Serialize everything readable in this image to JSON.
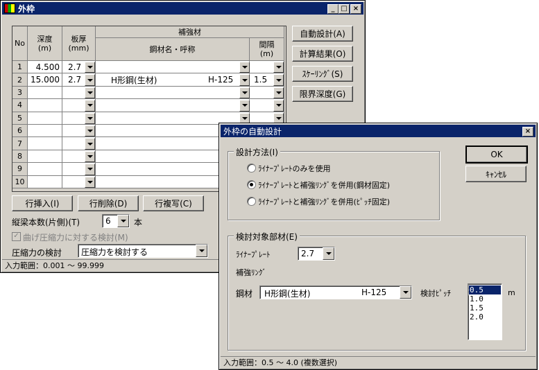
{
  "main_window": {
    "title": "外枠",
    "grid": {
      "headers": {
        "no": "No",
        "depth": "深度\n(m)",
        "thickness": "板厚\n(mm)",
        "reinforcement": "補強材",
        "steel_name": "鋼材名・呼称",
        "spacing": "間隔\n(m)"
      },
      "rows": [
        {
          "no": "1",
          "depth": "4.500",
          "thickness": "2.7",
          "steel_name": "",
          "steel_code": "",
          "spacing": ""
        },
        {
          "no": "2",
          "depth": "15.000",
          "thickness": "2.7",
          "steel_name": "H形鋼(生材)",
          "steel_code": "H-125",
          "spacing": "1.5"
        },
        {
          "no": "3",
          "depth": "",
          "thickness": "",
          "steel_name": "",
          "steel_code": "",
          "spacing": ""
        },
        {
          "no": "4",
          "depth": "",
          "thickness": "",
          "steel_name": "",
          "steel_code": "",
          "spacing": ""
        },
        {
          "no": "5",
          "depth": "",
          "thickness": "",
          "steel_name": "",
          "steel_code": "",
          "spacing": ""
        },
        {
          "no": "6",
          "depth": "",
          "thickness": "",
          "steel_name": "",
          "steel_code": "",
          "spacing": ""
        },
        {
          "no": "7",
          "depth": "",
          "thickness": "",
          "steel_name": "",
          "steel_code": "",
          "spacing": ""
        },
        {
          "no": "8",
          "depth": "",
          "thickness": "",
          "steel_name": "",
          "steel_code": "",
          "spacing": ""
        },
        {
          "no": "9",
          "depth": "",
          "thickness": "",
          "steel_name": "",
          "steel_code": "",
          "spacing": ""
        },
        {
          "no": "10",
          "depth": "",
          "thickness": "",
          "steel_name": "",
          "steel_code": "",
          "spacing": ""
        }
      ]
    },
    "side_buttons": {
      "auto_design": "自動設計(A)",
      "calc_result": "計算結果(O)",
      "scaling": "ｽｹｰﾘﾝｸﾞ(S)",
      "limit_depth": "限界深度(G)"
    },
    "row_buttons": {
      "insert": "行挿入(I)",
      "delete": "行削除(D)",
      "copy": "行複写(C)"
    },
    "beam_count_label": "縦梁本数(片側)(T)",
    "beam_count_value": "6",
    "beam_count_unit": "本",
    "bending_check_label": "曲げ圧縮力に対する検討(M)",
    "compression_label": "圧縮力の検討",
    "compression_value": "圧縮力を検討する",
    "status": "入力範囲：0.001 ～ 99.999"
  },
  "dialog": {
    "title": "外枠の自動設計",
    "method_group": "設計方法(I)",
    "methods": [
      "ﾗｲﾅｰﾌﾟﾚｰﾄのみを使用",
      "ﾗｲﾅｰﾌﾟﾚｰﾄと補強ﾘﾝｸﾞを併用(鋼材固定)",
      "ﾗｲﾅｰﾌﾟﾚｰﾄと補強ﾘﾝｸﾞを併用(ﾋﾟｯﾁ固定)"
    ],
    "selected_method": 1,
    "ok": "OK",
    "cancel": "ｷｬﾝｾﾙ",
    "target_group": "検討対象部材(E)",
    "liner_label": "ﾗｲﾅｰﾌﾟﾚｰﾄ",
    "liner_value": "2.7",
    "ring_label": "補強ﾘﾝｸﾞ",
    "steel_label": "鋼材",
    "steel_value": "H形鋼(生材)",
    "steel_code": "H-125",
    "pitch_label": "検討ﾋﾟｯﾁ",
    "pitch_options": [
      "0.5",
      "1.0",
      "1.5",
      "2.0"
    ],
    "pitch_unit": "m",
    "status": "入力範囲：0.5 ～ 4.0 (複数選択)"
  },
  "colors": {
    "face": "#d4d0c8",
    "title_bar": "#0a246a",
    "selection": "#0a246a"
  }
}
